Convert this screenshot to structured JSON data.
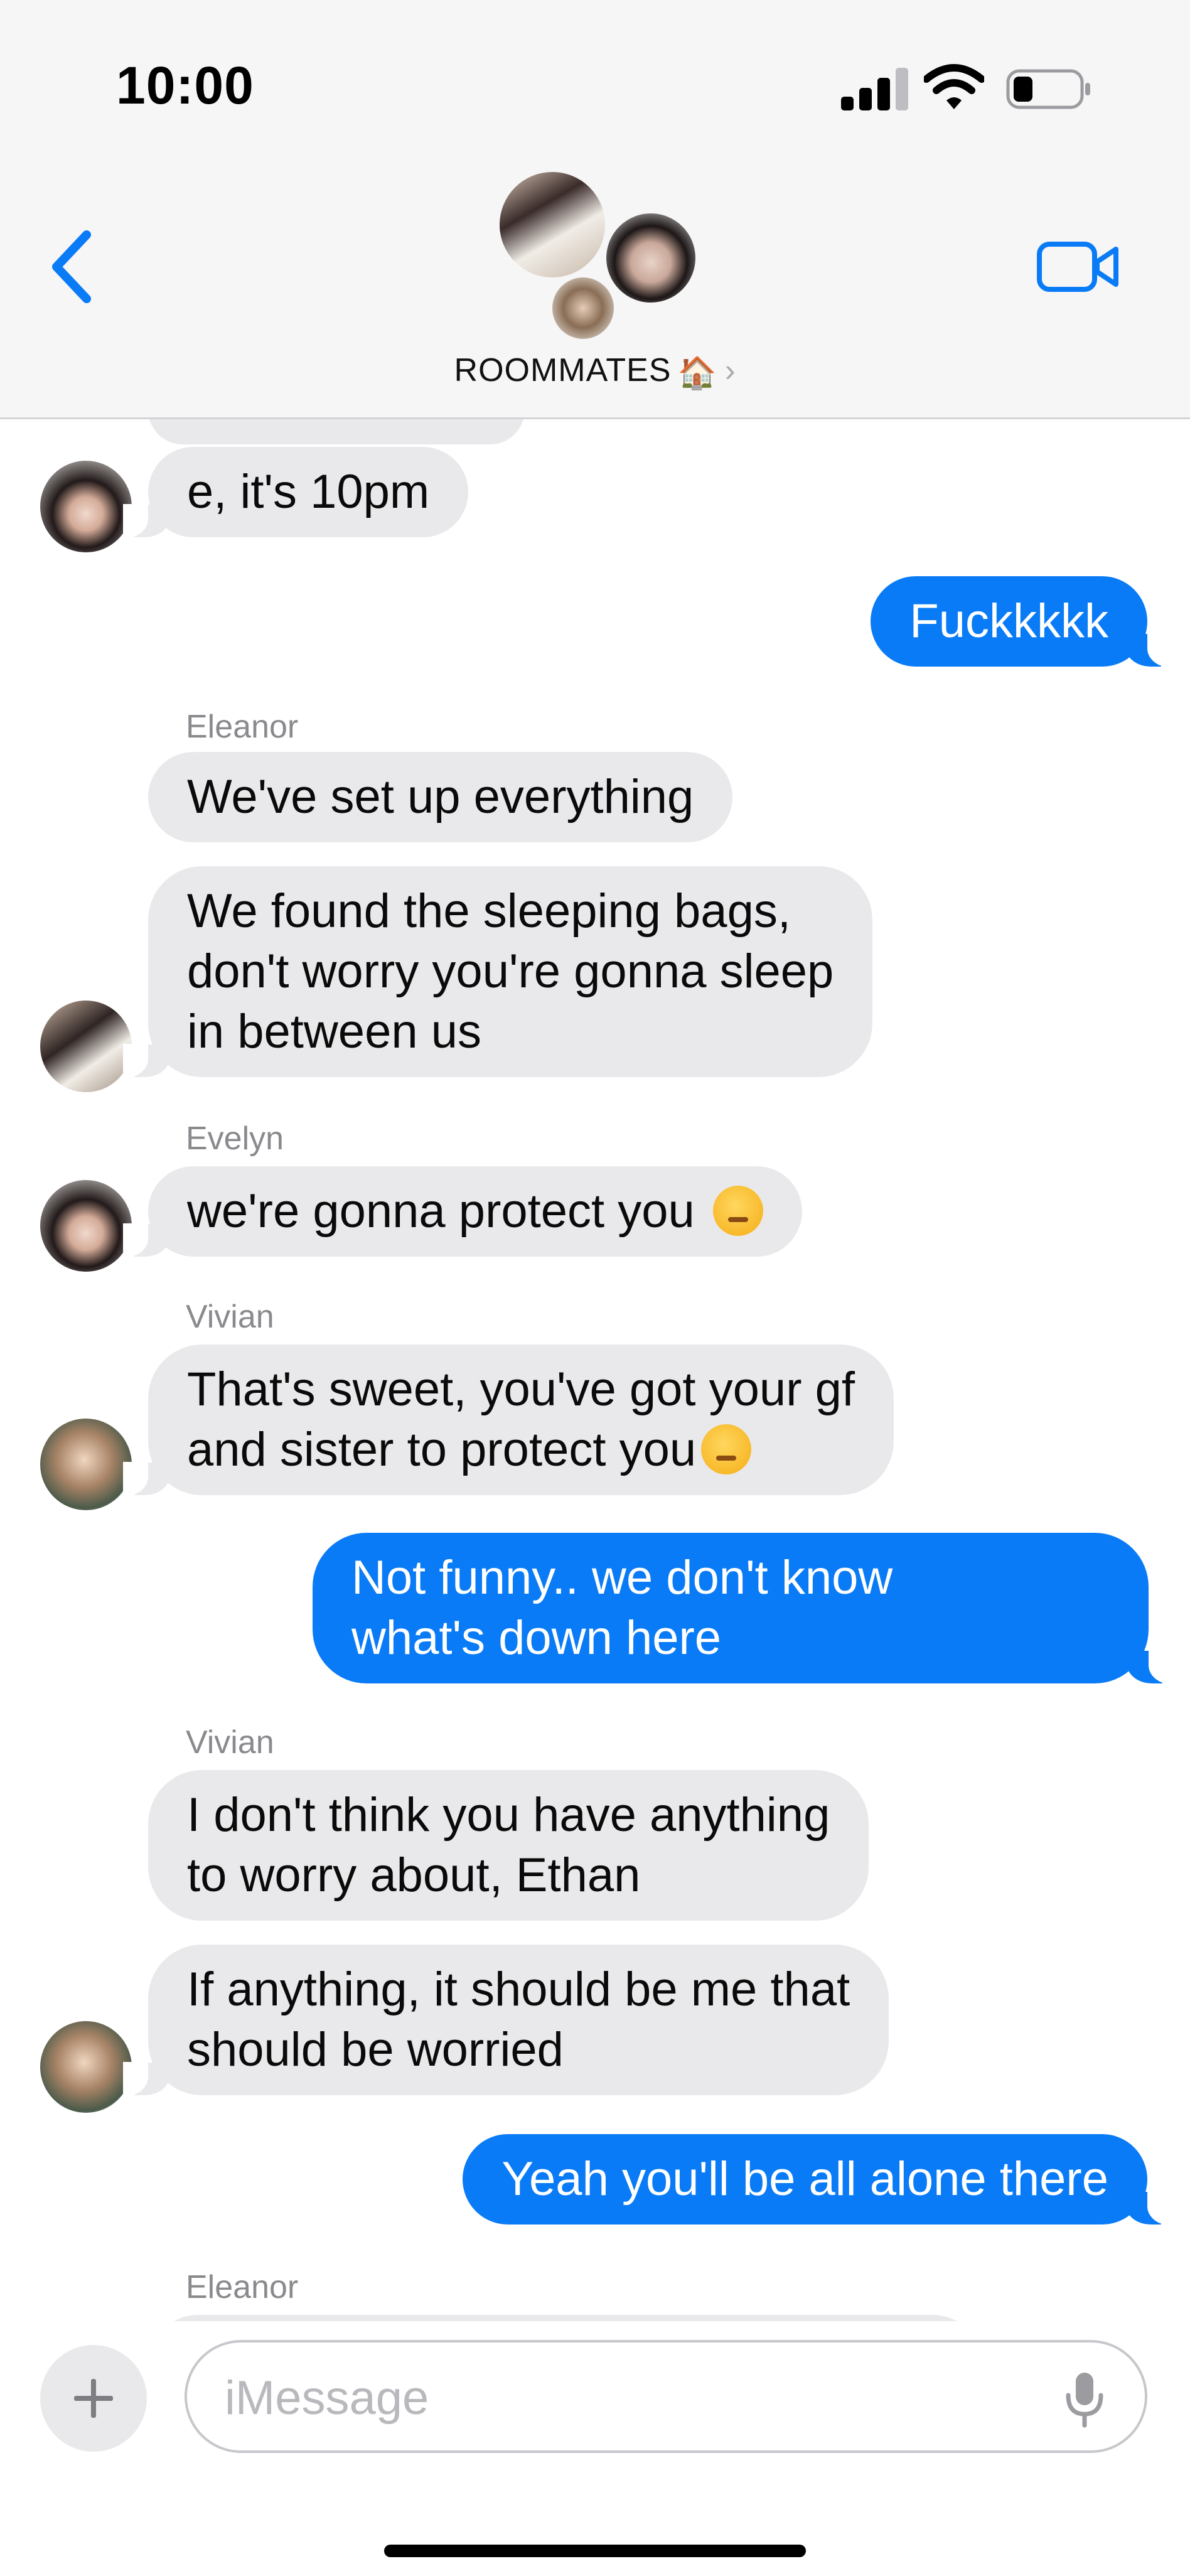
{
  "status_bar": {
    "time": "10:00",
    "icons": [
      "cellular-signal-icon",
      "wifi-icon",
      "battery-icon"
    ]
  },
  "header": {
    "back_icon": "chevron-left-icon",
    "group_name": "ROOMMATES",
    "group_emoji": "🏠",
    "chevron": "›",
    "video_icon": "facetime-video-icon",
    "accent_color": "#0a7bf6"
  },
  "messages": [
    {
      "direction": "in",
      "sender": "Evelyn",
      "text": "e, it's 10pm"
    },
    {
      "direction": "out",
      "text": "Fuckkkkk"
    },
    {
      "direction": "in",
      "sender_label": "Eleanor",
      "text": "We've set up everything"
    },
    {
      "direction": "in",
      "sender": "Eleanor",
      "lines": [
        "We found the sleeping bags,",
        "don't worry you're gonna sleep",
        "in between us"
      ]
    },
    {
      "direction": "in",
      "sender_label": "Evelyn",
      "text": "we're gonna protect you",
      "emoji_icon": "winking-face-emoji-icon"
    },
    {
      "direction": "in",
      "sender_label": "Vivian",
      "lines": [
        "That's sweet, you've got your gf",
        "and sister to protect you"
      ],
      "emoji_icon": "face-with-hand-over-mouth-emoji-icon"
    },
    {
      "direction": "out",
      "lines": [
        "Not funny.. we don't know",
        "what's down here"
      ]
    },
    {
      "direction": "in",
      "sender_label": "Vivian",
      "lines": [
        "I don't think you have anything",
        "to worry about, Ethan"
      ]
    },
    {
      "direction": "in",
      "sender": "Vivian",
      "lines": [
        "If anything, it should be me that",
        "should be worried"
      ]
    },
    {
      "direction": "out",
      "text": "Yeah you'll be all alone there"
    },
    {
      "direction": "in",
      "sender_label": "Eleanor"
    }
  ],
  "composer": {
    "placeholder": "iMessage",
    "value": "",
    "plus_icon": "plus-icon",
    "mic_icon": "microphone-icon"
  },
  "colors": {
    "incoming_bubble": "#e9e9eb",
    "outgoing_bubble": "#0a7bf6",
    "sender_label": "#8a8a8e",
    "header_background": "#f6f6f6"
  }
}
